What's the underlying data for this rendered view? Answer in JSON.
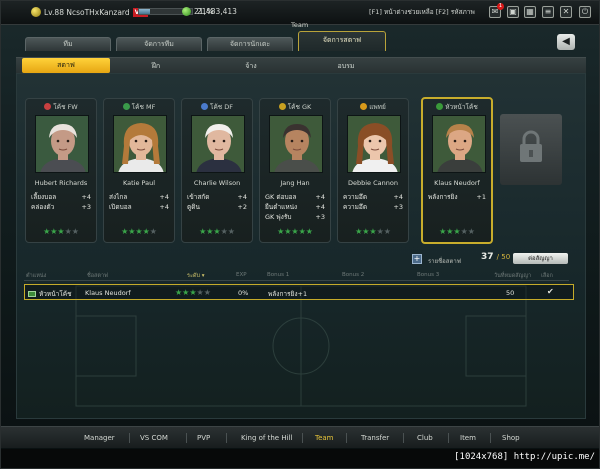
{
  "player": {
    "level": "Lv.88",
    "name": "NcsoTHxKanzard",
    "vip": "VIP",
    "xp_percent": "21%",
    "xp_fraction": 0.21,
    "gold": "21,483,413"
  },
  "topbar": {
    "hints": "[F1] หน้าต่างช่วยเหลือ [F2] รหัสภาพ",
    "mail_badge": "1"
  },
  "header": {
    "section": "Team",
    "back_label": "◀"
  },
  "tabs": [
    "ทีม",
    "จัดการทีม",
    "จัดการนักเตะ",
    "จัดการสตาฟ"
  ],
  "subtabs": [
    "สตาฟ",
    "ฝึก",
    "จ้าง",
    "อบรม"
  ],
  "staff": [
    {
      "role": "โค้ช FW",
      "name": "Hubert Richards",
      "stats": [
        [
          "เลี้ยงบอล",
          "+4"
        ],
        [
          "คล่องตัว",
          "+3"
        ]
      ],
      "stars": 3,
      "max_stars": 5,
      "skin": "#c49a86",
      "hair": "#e8e2dc",
      "shirt": "#4b4d52",
      "bg": "#3a5a3f",
      "role_color": "#c84040"
    },
    {
      "role": "โค้ช MF",
      "name": "Katie Paul",
      "stats": [
        [
          "ส่งไกล",
          "+4"
        ],
        [
          "เปิดบอล",
          "+4"
        ]
      ],
      "stars": 4,
      "max_stars": 5,
      "skin": "#e2b89a",
      "hair": "#b47a3a",
      "shirt": "#eaeaea",
      "bg": "#3e5a3a",
      "role_color": "#3a9a4a"
    },
    {
      "role": "โค้ช DF",
      "name": "Charlie Wilson",
      "stats": [
        [
          "เข้าสกัด",
          "+4"
        ],
        [
          "ตูดิน",
          "+2"
        ]
      ],
      "stars": 3,
      "max_stars": 5,
      "skin": "#e0b8a0",
      "hair": "#f2f0ec",
      "shirt": "#2b3040",
      "bg": "#3e5a3a",
      "role_color": "#4a7acb"
    },
    {
      "role": "โค้ช GK",
      "name": "Jang Han",
      "stats": [
        [
          "GK ต่อบอล",
          "+4"
        ],
        [
          "ยืนตำแหน่ง",
          "+4"
        ],
        [
          "GK พุ่งรับ",
          "+3"
        ]
      ],
      "stars": 5,
      "max_stars": 5,
      "skin": "#b68460",
      "hair": "#3a3230",
      "shirt": "#4a4e4a",
      "bg": "#3e5a3a",
      "role_color": "#c8a020"
    },
    {
      "role": "แพทย์",
      "name": "Debbie Cannon",
      "stats": [
        [
          "ความอึด",
          "+4"
        ],
        [
          "ความอึด",
          "+3"
        ]
      ],
      "stars": 3,
      "max_stars": 5,
      "skin": "#ecc6ac",
      "hair": "#8a4e26",
      "shirt": "#f0f0f0",
      "bg": "#3e5a3a",
      "role_color": "#d89a1a"
    },
    {
      "role": "หัวหน้าโค้ช",
      "name": "Klaus Neudorf",
      "stats": [
        [
          "พลังการยิง",
          "+1"
        ]
      ],
      "stars": 3,
      "max_stars": 5,
      "skin": "#dca784",
      "hair": "#b7824a",
      "shirt": "#3a3e3c",
      "bg": "#3e5a3a",
      "role_color": "#3a9a3a"
    }
  ],
  "roster": {
    "add_label": "รายชื่อสตาฟ",
    "count": "37",
    "max": "/ 50",
    "contract_button": "ต่อสัญญา"
  },
  "table": {
    "headers": [
      "ตำแหน่ง",
      "ชื่อสตาฟ",
      "ระดับ ▾",
      "EXP",
      "Bonus 1",
      "Bonus 2",
      "Bonus 3",
      "วันที่หมดสัญญา",
      "เลือก"
    ],
    "rows": [
      {
        "position": "หัวหน้าโค้ช",
        "name": "Klaus Neudorf",
        "stars": 3,
        "max_stars": 5,
        "exp": "0%",
        "bonus1": "พลังการยิง+1",
        "contract": "50",
        "selected": "✔"
      }
    ]
  },
  "bottom_nav": [
    "Manager",
    "VS COM",
    "PVP",
    "King of the Hill",
    "Team",
    "Transfer",
    "Club",
    "Item",
    "Shop"
  ],
  "bottom_nav_active": "Team",
  "watermark": "[1024x768] http://upic.me/"
}
